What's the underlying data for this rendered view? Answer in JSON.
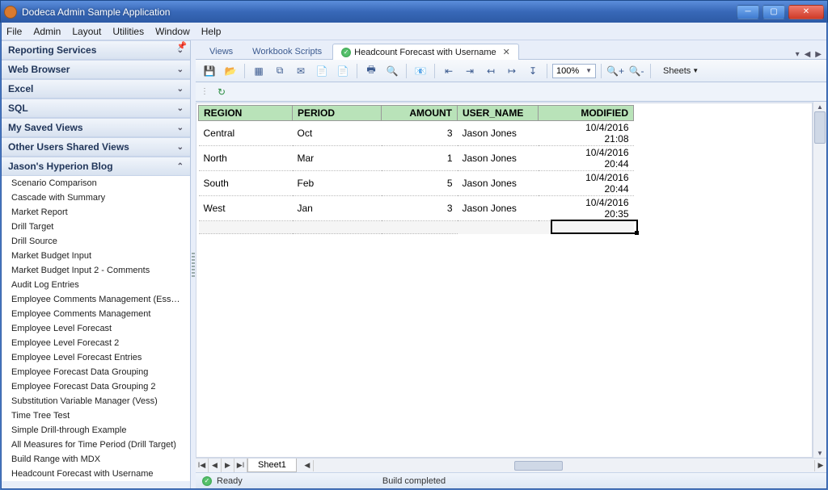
{
  "window": {
    "title": "Dodeca Admin Sample Application"
  },
  "menu": [
    "File",
    "Admin",
    "Layout",
    "Utilities",
    "Window",
    "Help"
  ],
  "sidebar": {
    "sections": [
      {
        "label": "Reporting Services",
        "open": false
      },
      {
        "label": "Web Browser",
        "open": false
      },
      {
        "label": "Excel",
        "open": false
      },
      {
        "label": "SQL",
        "open": false
      },
      {
        "label": "My Saved Views",
        "open": false
      },
      {
        "label": "Other Users Shared Views",
        "open": false
      },
      {
        "label": "Jason's Hyperion Blog",
        "open": true
      }
    ],
    "tree": [
      "Scenario Comparison",
      "Cascade with Summary",
      "Market Report",
      "Drill Target",
      "Drill Source",
      "Market Budget Input",
      "Market Budget Input 2 - Comments",
      "Audit Log Entries",
      "Employee Comments Management (Essbase V...",
      "Employee Comments Management",
      "Employee Level Forecast",
      "Employee Level Forecast 2",
      "Employee Level Forecast Entries",
      "Employee Forecast Data Grouping",
      "Employee Forecast Data Grouping 2",
      "Substitution Variable Manager (Vess)",
      "Time Tree Test",
      "Simple Drill-through Example",
      "All Measures for Time Period (Drill Target)",
      "Build Range with MDX",
      "Headcount Forecast with Username"
    ]
  },
  "tabs": {
    "items": [
      {
        "label": "Views"
      },
      {
        "label": "Workbook Scripts"
      },
      {
        "label": "Headcount Forecast with Username",
        "active": true
      }
    ]
  },
  "toolbar": {
    "zoom": "100%",
    "sheets": "Sheets"
  },
  "sheet": {
    "tab": "Sheet1",
    "headers": [
      "REGION",
      "PERIOD",
      "AMOUNT",
      "USER_NAME",
      "MODIFIED"
    ],
    "rows": [
      {
        "region": "Central",
        "period": "Oct",
        "amount": "3",
        "user": "Jason Jones",
        "modified": "10/4/2016 21:08"
      },
      {
        "region": "North",
        "period": "Mar",
        "amount": "1",
        "user": "Jason Jones",
        "modified": "10/4/2016 20:44"
      },
      {
        "region": "South",
        "period": "Feb",
        "amount": "5",
        "user": "Jason Jones",
        "modified": "10/4/2016 20:44"
      },
      {
        "region": "West",
        "period": "Jan",
        "amount": "3",
        "user": "Jason Jones",
        "modified": "10/4/2016 20:35"
      }
    ]
  },
  "status": {
    "left": "Ready",
    "center": "Build completed"
  }
}
